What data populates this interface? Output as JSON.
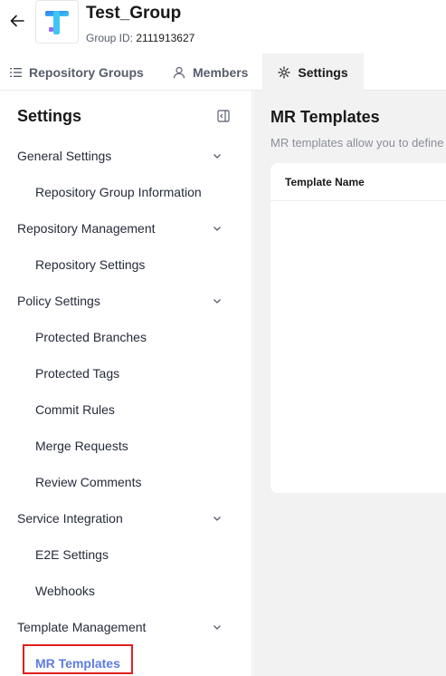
{
  "header": {
    "group_name": "Test_Group",
    "group_id_label": "Group ID:",
    "group_id_value": "2111913627",
    "logo_letter": "T",
    "brand_colors": [
      "#2f7cf6",
      "#3ec7f2",
      "#9b6cf5"
    ]
  },
  "tabs": [
    {
      "label": "Repository Groups",
      "icon": "list-icon"
    },
    {
      "label": "Members",
      "icon": "user-icon"
    },
    {
      "label": "Settings",
      "icon": "gear-icon",
      "selected": true
    }
  ],
  "sidebar": {
    "title": "Settings",
    "groups": [
      {
        "label": "General Settings",
        "items": [
          "Repository Group Information"
        ]
      },
      {
        "label": "Repository Management",
        "items": [
          "Repository Settings"
        ]
      },
      {
        "label": "Policy Settings",
        "items": [
          "Protected Branches",
          "Protected Tags",
          "Commit Rules",
          "Merge Requests",
          "Review Comments"
        ]
      },
      {
        "label": "Service Integration",
        "items": [
          "E2E Settings",
          "Webhooks"
        ]
      },
      {
        "label": "Template Management",
        "items": [
          "MR Templates"
        ]
      }
    ],
    "active_item": "MR Templates"
  },
  "main": {
    "title": "MR Templates",
    "description": "MR templates allow you to define",
    "table": {
      "columns": [
        "Template Name"
      ]
    }
  },
  "colors": {
    "accent": "#5e7ce0",
    "highlight": "#e0201c",
    "panel_bg": "#f2f2f2"
  }
}
